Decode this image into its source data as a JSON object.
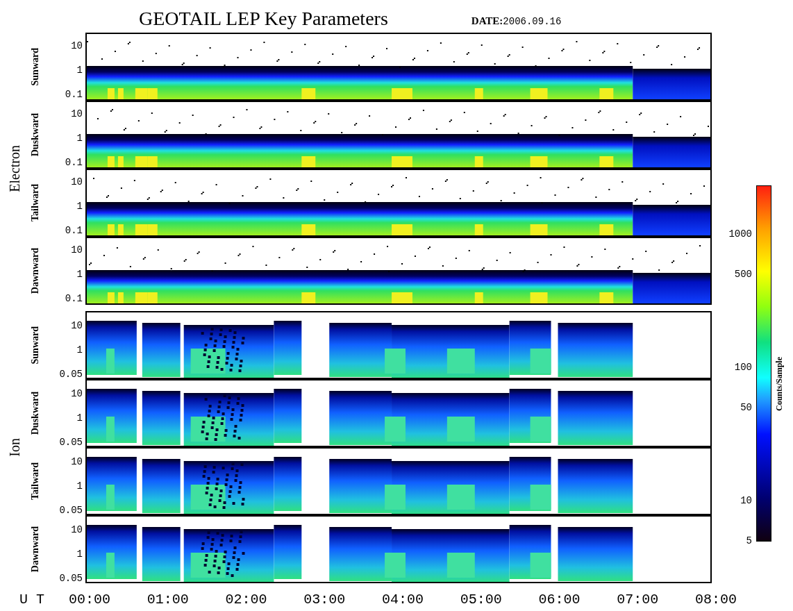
{
  "title": "GEOTAIL LEP Key Parameters",
  "date": {
    "label": "DATE:",
    "value": "2006.09.16"
  },
  "groups": [
    {
      "name": "Electron",
      "kind": "electron",
      "panels": [
        {
          "direction": "Sunward",
          "yticks": [
            "10",
            "1",
            "0.1"
          ]
        },
        {
          "direction": "Duskward",
          "yticks": [
            "10",
            "1",
            "0.1"
          ]
        },
        {
          "direction": "Tailward",
          "yticks": [
            "10",
            "1",
            "0.1"
          ]
        },
        {
          "direction": "Dawnward",
          "yticks": [
            "10",
            "1",
            "0.1"
          ]
        }
      ]
    },
    {
      "name": "Ion",
      "kind": "ion",
      "panels": [
        {
          "direction": "Sunward",
          "yticks": [
            "10",
            "1",
            "0.05"
          ]
        },
        {
          "direction": "Duskward",
          "yticks": [
            "10",
            "1",
            "0.05"
          ]
        },
        {
          "direction": "Tailward",
          "yticks": [
            "10",
            "1",
            "0.05"
          ]
        },
        {
          "direction": "Dawnward",
          "yticks": [
            "10",
            "1",
            "0.05"
          ]
        }
      ]
    }
  ],
  "x_axis": {
    "label": "U T",
    "ticks": [
      "00:00",
      "01:00",
      "02:00",
      "03:00",
      "04:00",
      "05:00",
      "06:00",
      "07:00",
      "08:00"
    ]
  },
  "colorbar": {
    "label": "Counts/Sample",
    "ticks": [
      "1000",
      "500",
      "100",
      "50",
      "10",
      "5"
    ]
  }
}
